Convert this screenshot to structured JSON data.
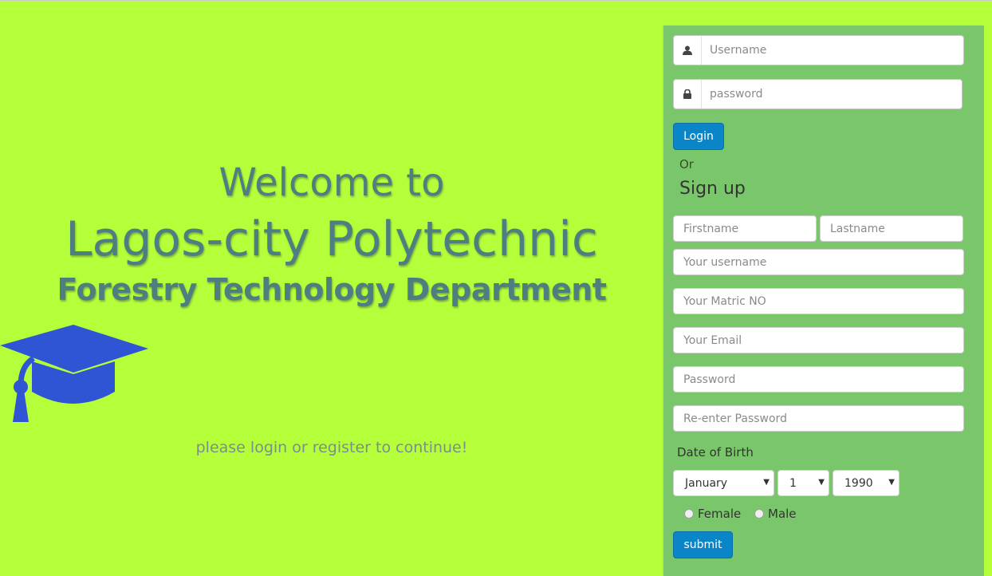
{
  "hero": {
    "welcome": "Welcome to",
    "school": "Lagos-city Polytechnic",
    "department": "Forestry Technology Department",
    "hint": "please login or register to continue!"
  },
  "login": {
    "username_placeholder": "Username",
    "password_placeholder": "password",
    "login_button": "Login",
    "or_text": "Or"
  },
  "signup": {
    "title": "Sign up",
    "firstname_placeholder": "Firstname",
    "lastname_placeholder": "Lastname",
    "username_placeholder": "Your username",
    "matric_placeholder": "Your Matric NO",
    "email_placeholder": "Your Email",
    "password_placeholder": "Password",
    "repassword_placeholder": "Re-enter Password",
    "dob_label": "Date of Birth",
    "month_value": "January",
    "day_value": "1",
    "year_value": "1990",
    "female_label": "Female",
    "male_label": "Male",
    "submit_button": "submit"
  },
  "colors": {
    "background": "#b5ff3a",
    "panel": "#7ac76b",
    "button": "#0a86c8",
    "heading": "#4e7f80",
    "cap_icon": "#2f55d4"
  },
  "icons": {
    "user": "user-icon",
    "lock": "lock-icon",
    "cap": "graduation-cap-icon"
  }
}
